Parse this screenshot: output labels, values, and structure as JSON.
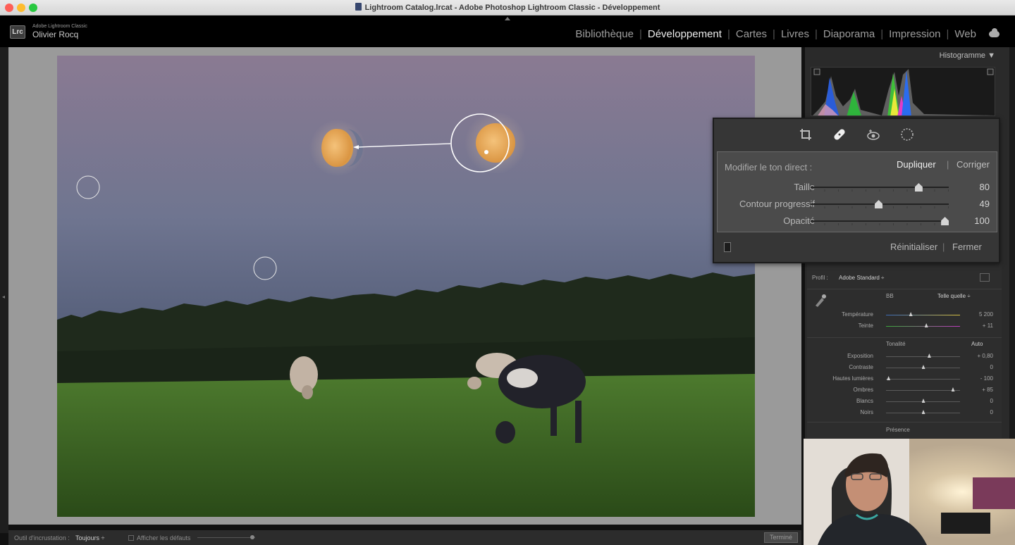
{
  "window": {
    "title": "Lightroom Catalog.lrcat - Adobe Photoshop Lightroom Classic - Développement"
  },
  "brand": {
    "logo": "Lrc",
    "product": "Adobe Lightroom Classic",
    "user": "Olivier Rocq"
  },
  "modules": [
    "Bibliothèque",
    "Développement",
    "Cartes",
    "Livres",
    "Diaporama",
    "Impression",
    "Web"
  ],
  "active_module": "Développement",
  "histogram": {
    "title": "Histogramme ▼"
  },
  "toolbox": {
    "tools": [
      "crop-icon",
      "healing-brush-icon",
      "red-eye-icon",
      "radial-filter-icon"
    ],
    "label": "Modifier le ton direct :",
    "mode_active": "Dupliquer",
    "mode_separator": "|",
    "mode_other": "Corriger",
    "sliders": [
      {
        "label": "Taille",
        "value": "80",
        "level": 0.78
      },
      {
        "label": "Contour progressif",
        "value": "49",
        "level": 0.49
      },
      {
        "label": "Opacité",
        "value": "100",
        "level": 0.97
      }
    ],
    "reset": "Réinitialiser",
    "footer_separator": "|",
    "close": "Fermer"
  },
  "basic": {
    "profile_label": "Profil :",
    "profile_value": "Adobe Standard ÷",
    "wb_label": "BB",
    "wb_value": "Telle quelle ÷",
    "rows1": [
      {
        "label": "Température",
        "value": "5 200",
        "level": 0.33
      },
      {
        "label": "Teinte",
        "value": "+ 11",
        "level": 0.54
      }
    ],
    "tone_label": "Tonalité",
    "auto": "Auto",
    "rows2": [
      {
        "label": "Exposition",
        "value": "+ 0,80",
        "level": 0.58
      },
      {
        "label": "Contraste",
        "value": "0",
        "level": 0.5
      },
      {
        "label": "Hautes lumières",
        "value": "- 100",
        "level": 0.03
      },
      {
        "label": "Ombres",
        "value": "+ 85",
        "level": 0.9
      },
      {
        "label": "Blancs",
        "value": "0",
        "level": 0.5
      },
      {
        "label": "Noirs",
        "value": "0",
        "level": 0.5
      }
    ],
    "presence": "Présence"
  },
  "statusbar": {
    "tool_label": "Outil d'incrustation :",
    "tool_value": "Toujours ÷",
    "defaults_label": "Afficher les défauts",
    "done": "Terminé"
  }
}
